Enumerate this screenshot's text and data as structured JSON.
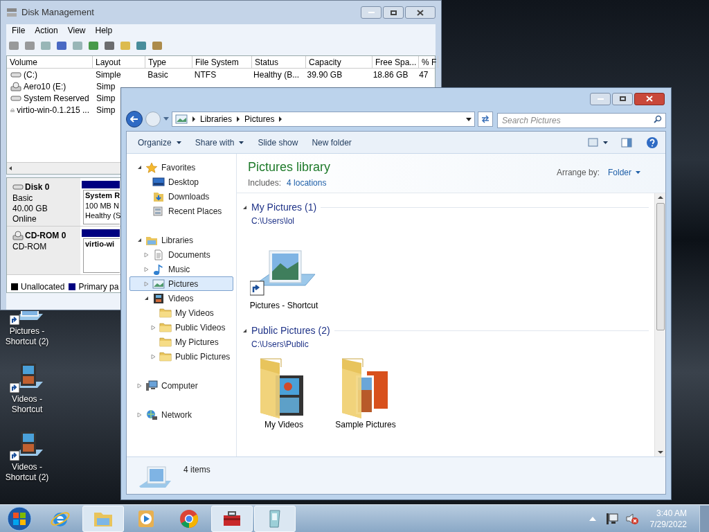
{
  "desktop_icons": [
    {
      "label": "Pictures - Shortcut (2)",
      "kind": "pictures"
    },
    {
      "label": "Videos - Shortcut",
      "kind": "videos"
    },
    {
      "label": "Videos - Shortcut (2)",
      "kind": "videos"
    }
  ],
  "disk_management": {
    "title": "Disk Management",
    "menu": [
      "File",
      "Action",
      "View",
      "Help"
    ],
    "volumes": {
      "columns": [
        "Volume",
        "Layout",
        "Type",
        "File System",
        "Status",
        "Capacity",
        "Free Spa...",
        "% F"
      ],
      "rows": [
        {
          "cells": [
            "(C:)",
            "Simple",
            "Basic",
            "NTFS",
            "Healthy (B...",
            "39.90 GB",
            "18.86 GB",
            "47"
          ],
          "kind": "hdd"
        },
        {
          "cells": [
            "Aero10 (E:)",
            "Simp"
          ],
          "kind": "cd"
        },
        {
          "cells": [
            "System Reserved",
            "Simp"
          ],
          "kind": "hdd"
        },
        {
          "cells": [
            "virtio-win-0.1.215 ...",
            "Simp"
          ],
          "kind": "cd"
        }
      ]
    },
    "disks": [
      {
        "name": "Disk 0",
        "kind": "hdd",
        "lines": [
          "Basic",
          "40.00 GB",
          "Online"
        ],
        "partition_title": "System R",
        "partition_lines": [
          "100 MB N",
          "Healthy (S"
        ]
      },
      {
        "name": "CD-ROM 0",
        "kind": "cd",
        "lines": [
          "CD-ROM"
        ],
        "partition_title": "virtio-wi"
      }
    ],
    "legend": [
      {
        "label": "Unallocated",
        "color": "#000000"
      },
      {
        "label": "Primary pa",
        "color": "#000080"
      }
    ]
  },
  "explorer": {
    "address": [
      "Libraries",
      "Pictures"
    ],
    "search": {
      "placeholder": "Search Pictures"
    },
    "toolbar": [
      {
        "label": "Organize",
        "dropdown": true
      },
      {
        "label": "Share with",
        "dropdown": true
      },
      {
        "label": "Slide show",
        "dropdown": false
      },
      {
        "label": "New folder",
        "dropdown": false
      }
    ],
    "nav": [
      {
        "label": "Favorites",
        "kind": "star",
        "expandable": true,
        "expanded": true,
        "selected": false,
        "children": [
          {
            "label": "Desktop",
            "kind": "desktop",
            "expandable": false,
            "selected": false
          },
          {
            "label": "Downloads",
            "kind": "downloads",
            "expandable": false,
            "selected": false
          },
          {
            "label": "Recent Places",
            "kind": "recent",
            "expandable": false,
            "selected": false
          }
        ]
      },
      {
        "label": "Libraries",
        "kind": "library",
        "expandable": true,
        "expanded": true,
        "selected": false,
        "children": [
          {
            "label": "Documents",
            "kind": "document",
            "expandable": true,
            "expanded": false,
            "selected": false
          },
          {
            "label": "Music",
            "kind": "music",
            "expandable": true,
            "expanded": false,
            "selected": false
          },
          {
            "label": "Pictures",
            "kind": "pictures",
            "expandable": true,
            "expanded": false,
            "selected": true
          },
          {
            "label": "Videos",
            "kind": "videos",
            "expandable": true,
            "expanded": true,
            "selected": false,
            "children": [
              {
                "label": "My Videos",
                "kind": "folder",
                "expandable": false,
                "selected": false
              },
              {
                "label": "Public Videos",
                "kind": "folder",
                "expandable": true,
                "expanded": false,
                "selected": false
              },
              {
                "label": "My Pictures",
                "kind": "folder",
                "expandable": false,
                "selected": false
              },
              {
                "label": "Public Pictures",
                "kind": "folder",
                "expandable": true,
                "expanded": false,
                "selected": false
              }
            ]
          }
        ]
      },
      {
        "label": "Computer",
        "kind": "computer",
        "expandable": true,
        "expanded": false,
        "selected": false
      },
      {
        "label": "Network",
        "kind": "network",
        "expandable": true,
        "expanded": false,
        "selected": false
      }
    ],
    "library": {
      "title": "Pictures library",
      "includes_label": "Includes:",
      "includes_link": "4 locations",
      "arrange_label": "Arrange by:",
      "arrange_value": "Folder"
    },
    "groups": [
      {
        "title": "My Pictures (1)",
        "path": "C:\\Users\\lol",
        "expanded": true,
        "items": [
          {
            "label": "Pictures - Shortcut",
            "kind": "library-shortcut"
          }
        ]
      },
      {
        "title": "Public Pictures (2)",
        "path": "C:\\Users\\Public",
        "expanded": true,
        "items": [
          {
            "label": "My Videos",
            "kind": "videos-folder"
          },
          {
            "label": "Sample Pictures",
            "kind": "pictures-folder"
          }
        ]
      }
    ],
    "status": "4 items"
  },
  "taskbar": {
    "items": [
      {
        "kind": "start",
        "running": false
      },
      {
        "kind": "browser-e",
        "running": false
      },
      {
        "kind": "explorer",
        "running": true
      },
      {
        "kind": "media",
        "running": false
      },
      {
        "kind": "chrome",
        "running": false
      },
      {
        "kind": "toolbox",
        "running": true
      },
      {
        "kind": "app",
        "running": true
      }
    ],
    "time": "3:40 AM",
    "date": "7/29/2022"
  }
}
